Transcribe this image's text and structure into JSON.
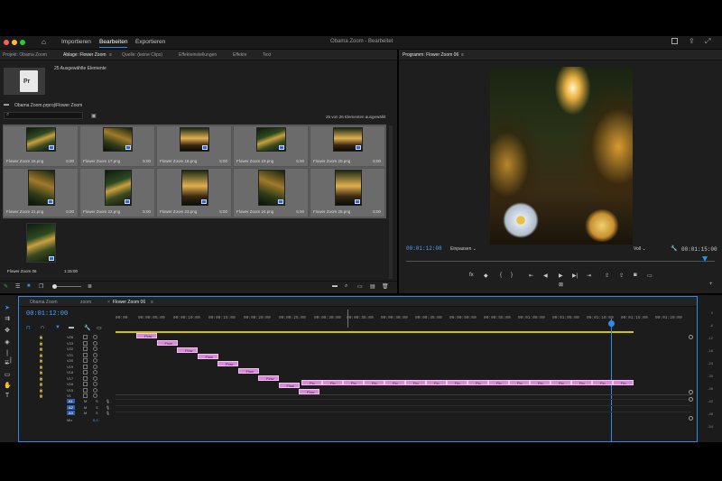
{
  "topbar": {
    "nav": [
      "Importieren",
      "Bearbeiten",
      "Exportieren"
    ],
    "active_nav": "Bearbeiten",
    "title": "Obama Zoom - Bearbeitet",
    "colors": {
      "close": "#ff5f57",
      "min": "#febc2e",
      "max": "#28c840",
      "accent": "#2d8ceb"
    }
  },
  "project_panel": {
    "tabs": [
      "Projekt: Obama Zoom",
      "Ablage: Flower Zoom",
      "Quelle: (keine Clips)",
      "Effekteinstellungen",
      "Effekte",
      "Text"
    ],
    "file_icon_label": "Pr",
    "selected_summary": "25 Ausgewählte Elemente",
    "path": "Obama Zoom.prproj\\Flower Zoom",
    "count": "25 von 26 Elementen ausgewählt",
    "items": [
      {
        "name": "Flower Zoom 16.png",
        "duration": "5:00"
      },
      {
        "name": "Flower Zoom 17.png",
        "duration": "5:00"
      },
      {
        "name": "Flower Zoom 18.png",
        "duration": "5:00"
      },
      {
        "name": "Flower Zoom 19.png",
        "duration": "5:00"
      },
      {
        "name": "Flower Zoom 20.png",
        "duration": "5:00"
      },
      {
        "name": "Flower Zoom 21.png",
        "duration": "5:00"
      },
      {
        "name": "Flower Zoom 22.png",
        "duration": "5:00"
      },
      {
        "name": "Flower Zoom 23.png",
        "duration": "5:00"
      },
      {
        "name": "Flower Zoom 24.png",
        "duration": "5:00"
      },
      {
        "name": "Flower Zoom 25.png",
        "duration": "5:00"
      }
    ],
    "sequence_item": {
      "name": "Flower Zoom 06",
      "duration": "1:15:00"
    }
  },
  "program_monitor": {
    "title": "Programm: Flower Zoom 06",
    "timecode": "00:01:12:08",
    "fit": "Einpassen",
    "quality": "Voll",
    "duration": "00:01:15:00"
  },
  "timeline": {
    "tabs": [
      "Obama Zoom",
      "zoom",
      "Flower Zoom 06"
    ],
    "timecode": "00:01:12:00",
    "ruler": [
      "00:00",
      "00:00:05:00",
      "00:00:10:00",
      "00:00:15:00",
      "00:00:20:00",
      "00:00:25:00",
      "00:00:30:00",
      "00:00:35:00",
      "00:00:40:00",
      "00:00:45:00",
      "00:00:50:00",
      "00:00:55:00",
      "00:01:00:00",
      "00:01:05:00",
      "00:01:10:00",
      "00:01:15:00",
      "00:01:20:00"
    ],
    "video_tracks": [
      "V26",
      "V23",
      "V22",
      "V21",
      "V20",
      "V19",
      "V18",
      "V17",
      "V16",
      "V15",
      "V1"
    ],
    "audio_tracks": [
      "A1",
      "A2",
      "A3"
    ],
    "mix_label": "Mix",
    "mix_value": "0,0",
    "clip_label": "Flow",
    "clip_short": "Flo",
    "meter_labels": [
      "0",
      "-6",
      "-12",
      "-18",
      "-24",
      "-30",
      "-36",
      "-42",
      "-48",
      "-54"
    ]
  }
}
